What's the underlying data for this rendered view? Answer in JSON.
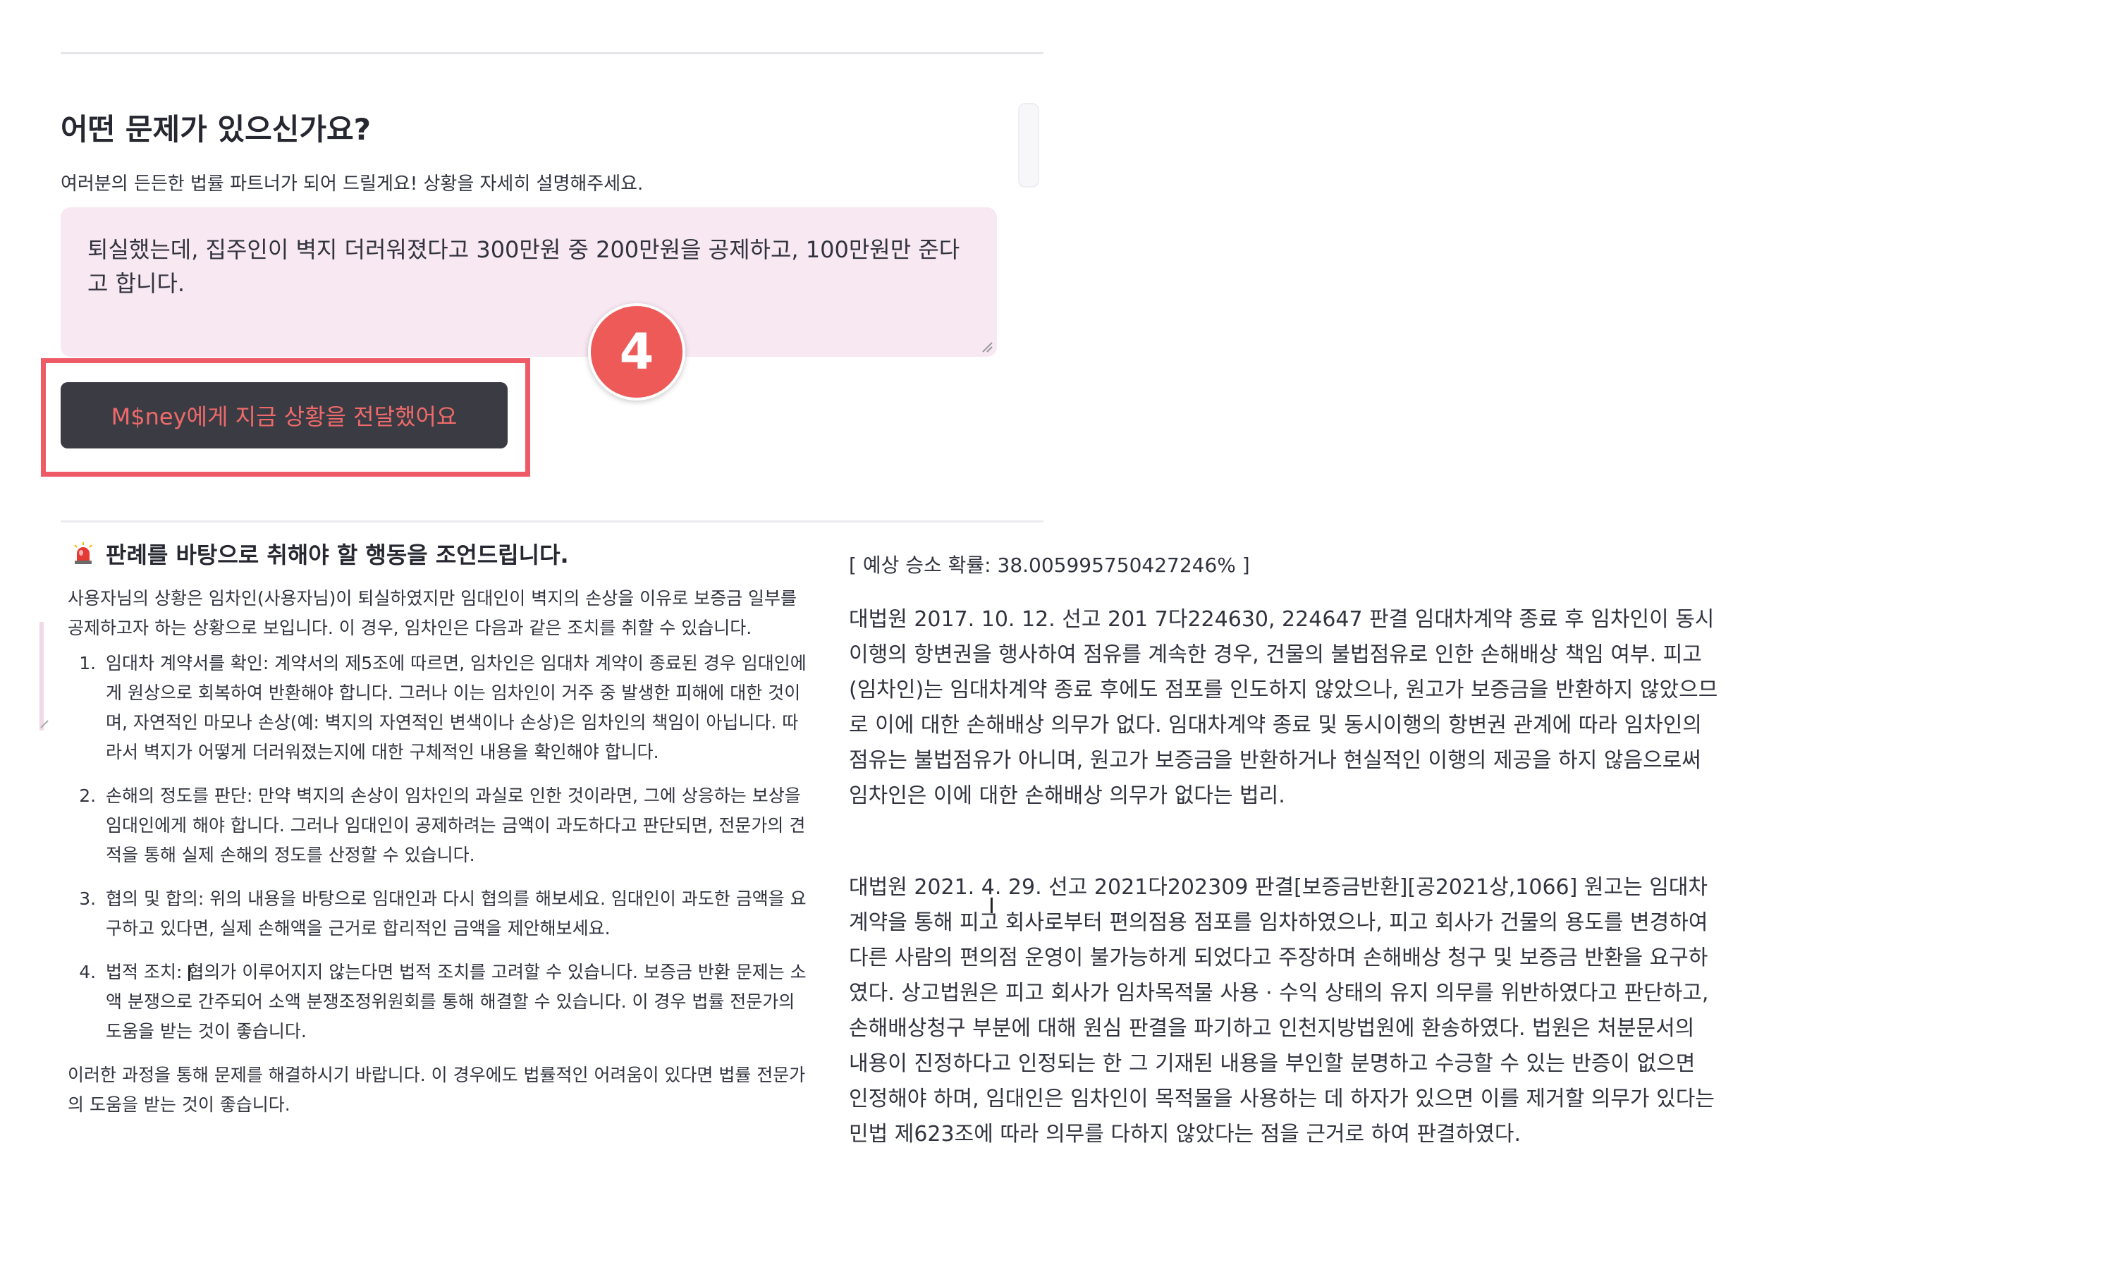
{
  "form": {
    "heading": "어떤 문제가 있으신가요?",
    "subtext": "여러분의 든든한 법률 파트너가 되어 드릴게요! 상황을 자세히 설명해주세요.",
    "textarea_value": "퇴실했는데, 집주인이 벽지 더러워졌다고 300만원 중 200만원을 공제하고, 100만원만 준다고 합니다.",
    "submit_label": "M$ney에게 지금 상황을 전달했어요",
    "step_number": "4"
  },
  "advice": {
    "title": "판례를 바탕으로 취해야 할 행동을 조언드립니다.",
    "title_icon": "siren-icon",
    "intro": "사용자님의 상황은 임차인(사용자님)이 퇴실하였지만 임대인이 벽지의 손상을 이유로 보증금 일부를 공제하고자 하는 상황으로 보입니다. 이 경우, 임차인은 다음과 같은 조치를 취할 수 있습니다.",
    "steps": [
      "임대차 계약서를 확인: 계약서의 제5조에 따르면, 임차인은 임대차 계약이 종료된 경우 임대인에게 원상으로 회복하여 반환해야 합니다. 그러나 이는 임차인이 거주 중 발생한 피해에 대한 것이며, 자연적인 마모나 손상(예: 벽지의 자연적인 변색이나 손상)은 임차인의 책임이 아닙니다. 따라서 벽지가 어떻게 더러워졌는지에 대한 구체적인 내용을 확인해야 합니다.",
      "손해의 정도를 판단: 만약 벽지의 손상이 임차인의 과실로 인한 것이라면, 그에 상응하는 보상을 임대인에게 해야 합니다. 그러나 임대인이 공제하려는 금액이 과도하다고 판단되면, 전문가의 견적을 통해 실제 손해의 정도를 산정할 수 있습니다.",
      "협의 및 합의: 위의 내용을 바탕으로 임대인과 다시 협의를 해보세요. 임대인이 과도한 금액을 요구하고 있다면, 실제 손해액을 근거로 합리적인 금액을 제안해보세요.",
      "법적 조치: 협의가 이루어지지 않는다면 법적 조치를 고려할 수 있습니다. 보증금 반환 문제는 소액 분쟁으로 간주되어 소액 분쟁조정위원회를 통해 해결할 수 있습니다. 이 경우 법률 전문가의 도움을 받는 것이 좋습니다."
    ],
    "closing": "이러한 과정을 통해 문제를 해결하시기 바랍니다. 이 경우에도 법률적인 어려움이 있다면 법률 전문가의 도움을 받는 것이 좋습니다."
  },
  "result": {
    "probability": "[ 예상 승소 확률: 38.005995750427246% ]",
    "precedents": [
      "대법원 2017. 10. 12. 선고 201 7다224630, 224647 판결 임대차계약 종료 후 임차인이 동시이행의 항변권을 행사하여 점유를 계속한 경우, 건물의 불법점유로 인한 손해배상 책임 여부. 피고(임차인)는 임대차계약 종료 후에도 점포를 인도하지 않았으나, 원고가 보증금을 반환하지 않았으므로 이에 대한 손해배상 의무가 없다. 임대차계약 종료 및 동시이행의 항변권 관계에 따라 임차인의 점유는 불법점유가 아니며, 원고가 보증금을 반환하거나 현실적인 이행의 제공을 하지 않음으로써 임차인은 이에 대한 손해배상 의무가 없다는 법리.",
      "대법원 2021. 4. 29. 선고 2021다202309 판결[보증금반환][공2021상,1066] 원고는 임대차계약을 통해 피고 회사로부터 편의점용 점포를 임차하였으나, 피고 회사가 건물의 용도를 변경하여 다른 사람의 편의점 운영이 불가능하게 되었다고 주장하며 손해배상 청구 및 보증금 반환을 요구하였다. 상고법원은 피고 회사가 임차목적물 사용 · 수익 상태의 유지 의무를 위반하였다고 판단하고, 손해배상청구 부분에 대해 원심 판결을 파기하고 인천지방법원에 환송하였다. 법원은 처분문서의 내용이 진정하다고 인정되는 한 그 기재된 내용을 부인할 분명하고 수긍할 수 있는 반증이 없으면 인정해야 하며, 임대인은 임차인이 목적물을 사용하는 데 하자가 있으면 이를 제거할 의무가 있다는 민법 제623조에 따라 의무를 다하지 않았다는 점을 근거로 하여 판결하였다."
    ]
  },
  "colors": {
    "accent_red": "#ee5a57",
    "button_bg": "#3a3b43",
    "button_text": "#ee6a6a",
    "textarea_bg": "#f7e8f2"
  }
}
